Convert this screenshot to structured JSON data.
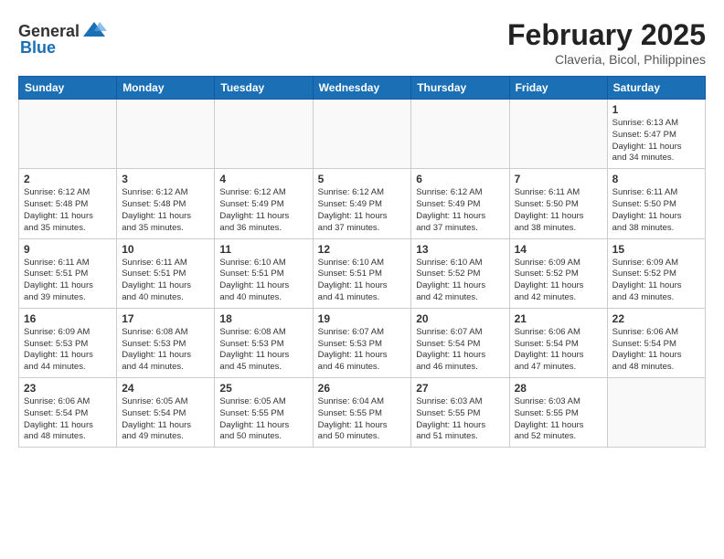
{
  "logo": {
    "general": "General",
    "blue": "Blue"
  },
  "title": "February 2025",
  "location": "Claveria, Bicol, Philippines",
  "days_of_week": [
    "Sunday",
    "Monday",
    "Tuesday",
    "Wednesday",
    "Thursday",
    "Friday",
    "Saturday"
  ],
  "weeks": [
    [
      {
        "day": "",
        "info": ""
      },
      {
        "day": "",
        "info": ""
      },
      {
        "day": "",
        "info": ""
      },
      {
        "day": "",
        "info": ""
      },
      {
        "day": "",
        "info": ""
      },
      {
        "day": "",
        "info": ""
      },
      {
        "day": "1",
        "info": "Sunrise: 6:13 AM\nSunset: 5:47 PM\nDaylight: 11 hours\nand 34 minutes."
      }
    ],
    [
      {
        "day": "2",
        "info": "Sunrise: 6:12 AM\nSunset: 5:48 PM\nDaylight: 11 hours\nand 35 minutes."
      },
      {
        "day": "3",
        "info": "Sunrise: 6:12 AM\nSunset: 5:48 PM\nDaylight: 11 hours\nand 35 minutes."
      },
      {
        "day": "4",
        "info": "Sunrise: 6:12 AM\nSunset: 5:49 PM\nDaylight: 11 hours\nand 36 minutes."
      },
      {
        "day": "5",
        "info": "Sunrise: 6:12 AM\nSunset: 5:49 PM\nDaylight: 11 hours\nand 37 minutes."
      },
      {
        "day": "6",
        "info": "Sunrise: 6:12 AM\nSunset: 5:49 PM\nDaylight: 11 hours\nand 37 minutes."
      },
      {
        "day": "7",
        "info": "Sunrise: 6:11 AM\nSunset: 5:50 PM\nDaylight: 11 hours\nand 38 minutes."
      },
      {
        "day": "8",
        "info": "Sunrise: 6:11 AM\nSunset: 5:50 PM\nDaylight: 11 hours\nand 38 minutes."
      }
    ],
    [
      {
        "day": "9",
        "info": "Sunrise: 6:11 AM\nSunset: 5:51 PM\nDaylight: 11 hours\nand 39 minutes."
      },
      {
        "day": "10",
        "info": "Sunrise: 6:11 AM\nSunset: 5:51 PM\nDaylight: 11 hours\nand 40 minutes."
      },
      {
        "day": "11",
        "info": "Sunrise: 6:10 AM\nSunset: 5:51 PM\nDaylight: 11 hours\nand 40 minutes."
      },
      {
        "day": "12",
        "info": "Sunrise: 6:10 AM\nSunset: 5:51 PM\nDaylight: 11 hours\nand 41 minutes."
      },
      {
        "day": "13",
        "info": "Sunrise: 6:10 AM\nSunset: 5:52 PM\nDaylight: 11 hours\nand 42 minutes."
      },
      {
        "day": "14",
        "info": "Sunrise: 6:09 AM\nSunset: 5:52 PM\nDaylight: 11 hours\nand 42 minutes."
      },
      {
        "day": "15",
        "info": "Sunrise: 6:09 AM\nSunset: 5:52 PM\nDaylight: 11 hours\nand 43 minutes."
      }
    ],
    [
      {
        "day": "16",
        "info": "Sunrise: 6:09 AM\nSunset: 5:53 PM\nDaylight: 11 hours\nand 44 minutes."
      },
      {
        "day": "17",
        "info": "Sunrise: 6:08 AM\nSunset: 5:53 PM\nDaylight: 11 hours\nand 44 minutes."
      },
      {
        "day": "18",
        "info": "Sunrise: 6:08 AM\nSunset: 5:53 PM\nDaylight: 11 hours\nand 45 minutes."
      },
      {
        "day": "19",
        "info": "Sunrise: 6:07 AM\nSunset: 5:53 PM\nDaylight: 11 hours\nand 46 minutes."
      },
      {
        "day": "20",
        "info": "Sunrise: 6:07 AM\nSunset: 5:54 PM\nDaylight: 11 hours\nand 46 minutes."
      },
      {
        "day": "21",
        "info": "Sunrise: 6:06 AM\nSunset: 5:54 PM\nDaylight: 11 hours\nand 47 minutes."
      },
      {
        "day": "22",
        "info": "Sunrise: 6:06 AM\nSunset: 5:54 PM\nDaylight: 11 hours\nand 48 minutes."
      }
    ],
    [
      {
        "day": "23",
        "info": "Sunrise: 6:06 AM\nSunset: 5:54 PM\nDaylight: 11 hours\nand 48 minutes."
      },
      {
        "day": "24",
        "info": "Sunrise: 6:05 AM\nSunset: 5:54 PM\nDaylight: 11 hours\nand 49 minutes."
      },
      {
        "day": "25",
        "info": "Sunrise: 6:05 AM\nSunset: 5:55 PM\nDaylight: 11 hours\nand 50 minutes."
      },
      {
        "day": "26",
        "info": "Sunrise: 6:04 AM\nSunset: 5:55 PM\nDaylight: 11 hours\nand 50 minutes."
      },
      {
        "day": "27",
        "info": "Sunrise: 6:03 AM\nSunset: 5:55 PM\nDaylight: 11 hours\nand 51 minutes."
      },
      {
        "day": "28",
        "info": "Sunrise: 6:03 AM\nSunset: 5:55 PM\nDaylight: 11 hours\nand 52 minutes."
      },
      {
        "day": "",
        "info": ""
      }
    ]
  ]
}
